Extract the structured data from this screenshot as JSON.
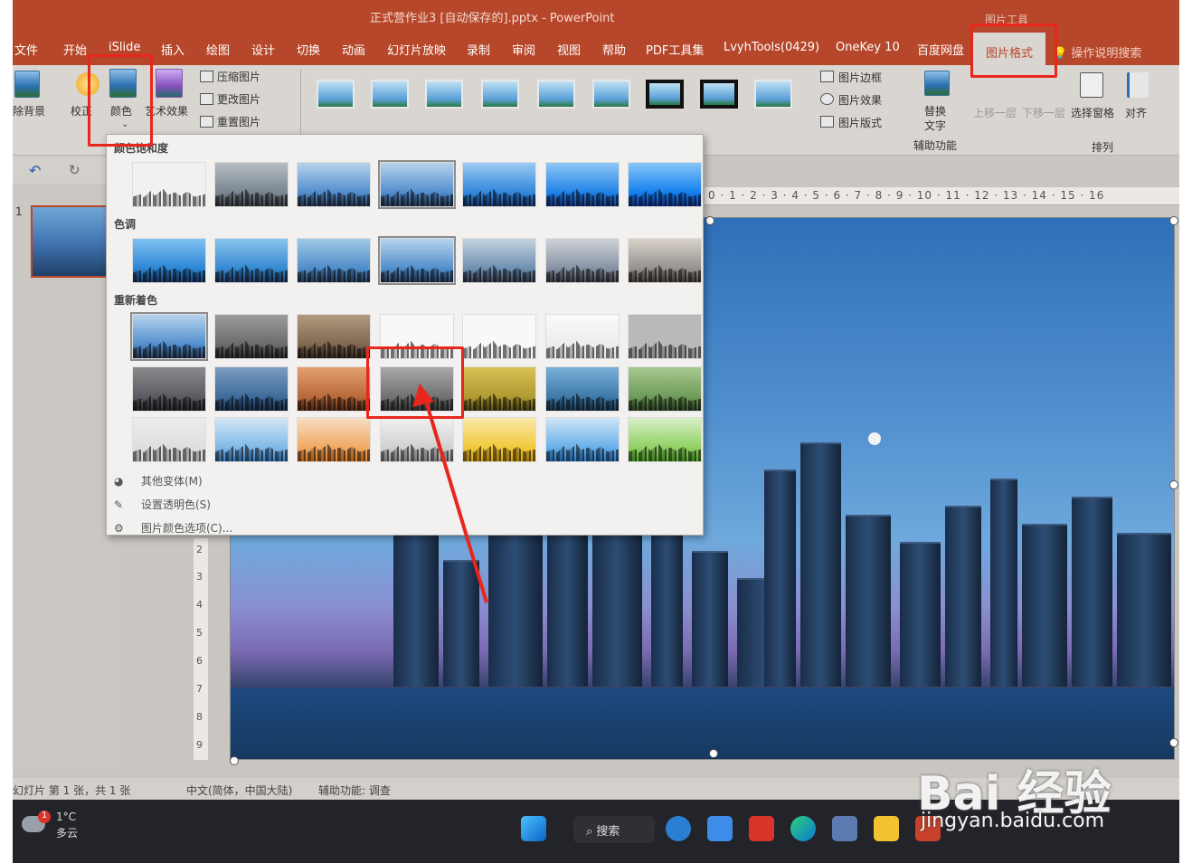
{
  "window": {
    "title": "正式营作业3 [自动保存的].pptx  -  PowerPoint",
    "tools_label": "图片工具"
  },
  "tabs": [
    "文件",
    "开始",
    "iSlide",
    "插入",
    "绘图",
    "设计",
    "切换",
    "动画",
    "幻灯片放映",
    "录制",
    "审阅",
    "视图",
    "帮助",
    "PDF工具集",
    "LvyhTools(0429)",
    "OneKey 10",
    "百度网盘",
    "图片格式"
  ],
  "active_tab": "图片格式",
  "help_search": "操作说明搜索",
  "ribbon": {
    "remove_bg": "除背景",
    "corrections": "校正",
    "color": "颜色",
    "artistic": "艺术效果",
    "compress": "压缩图片",
    "change": "更改图片",
    "reset": "重置图片",
    "picture_border": "图片边框",
    "picture_effects": "图片效果",
    "picture_layout": "图片版式",
    "alt_text_1": "替换",
    "alt_text_2": "文字",
    "accessibility": "辅助功能",
    "bring_forward": "上移一层",
    "send_backward": "下移一层",
    "selection_pane": "选择窗格",
    "align": "对齐",
    "arrange": "排列"
  },
  "panel": {
    "sec_saturation": "颜色饱和度",
    "sec_tone": "色调",
    "sec_recolor": "重新着色",
    "more_variations": "其他变体(M)",
    "set_transparent": "设置透明色(S)",
    "color_options": "图片颜色选项(C)..."
  },
  "ruler_marks": "0 · 1 · 2 · 3 · 4 · 5 · 6 · 7 · 8 · 9 · 10 · 11 · 12 · 13 · 14 · 15 · 16",
  "ruler_left_marks": [
    "2",
    "3",
    "4",
    "5",
    "6",
    "7",
    "8",
    "9"
  ],
  "slide_number_label": "1",
  "status": {
    "slide_info": "幻灯片 第 1 张，共 1 张",
    "language": "中文(简体，中国大陆)",
    "accessibility": "辅助功能: 调查"
  },
  "taskbar": {
    "temp": "1°C",
    "weather": "多云",
    "search": "搜索",
    "badge": "1"
  },
  "watermark": {
    "brand": "Bai 经验",
    "url": "jingyan.baidu.com"
  },
  "colors": {
    "accent": "#b7472a",
    "highlight": "#e8261c"
  }
}
